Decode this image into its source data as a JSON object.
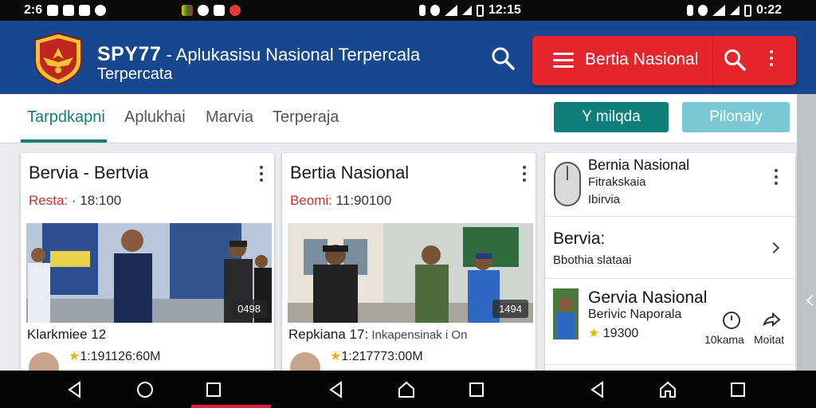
{
  "statusbar": {
    "left_time": "2:6",
    "center_time": "12:15",
    "right_time": "0:22"
  },
  "header": {
    "title_brand": "SPY77",
    "title_rest": " - Aplukasisu Nasional Terpercala",
    "subtitle": "Terpercata",
    "menu_label": "Bertia Nasional"
  },
  "tabs": [
    {
      "label": "Tarpdkapni"
    },
    {
      "label": "Aplukhai"
    },
    {
      "label": "Marvia"
    },
    {
      "label": "Terperaja"
    }
  ],
  "buttons": {
    "primary": "Y milqda",
    "secondary": "Pilonaly"
  },
  "cards": [
    {
      "title": "Bervia - Bertvia",
      "meta_label": "Resta:",
      "meta_value": " · 18:100",
      "image_badge": "0498",
      "caption_main": "Klarkmiee 12",
      "caption_extra": "",
      "rating": "1:191126:60M"
    },
    {
      "title": "Bertia Nasional",
      "meta_label": "Beomi:",
      "meta_value": " 11:90100",
      "image_badge": "1494",
      "caption_main": "Repkiana 17:",
      "caption_extra": " Inkapensinak i On",
      "rating": "1:217773:00M"
    }
  ],
  "side_list": {
    "item1": {
      "title": "Bernia Nasional",
      "line2": "Fitrakskaia",
      "line3": "Ibirvia"
    },
    "item2": {
      "title": "Bervia:",
      "subtitle": "Bbothia slataai"
    },
    "item3": {
      "title": "Gervia Nasional",
      "line2": "Berivic Naporala",
      "rating": "19300",
      "action1": "10kama",
      "action2": "Moitat"
    }
  },
  "colors": {
    "header_blue": "#17478f",
    "accent_red": "#e5242b",
    "teal": "#0f7f7a",
    "light_teal": "#78c9d3"
  }
}
